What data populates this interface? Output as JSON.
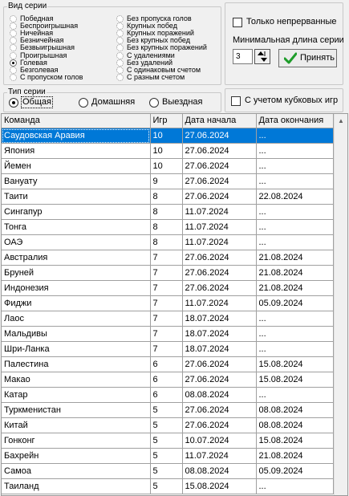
{
  "series_kind": {
    "legend": "Вид серии",
    "left_options": [
      {
        "label": "Победная",
        "checked": false
      },
      {
        "label": "Беспроигрышная",
        "checked": false
      },
      {
        "label": "Ничейная",
        "checked": false
      },
      {
        "label": "Безничейная",
        "checked": false
      },
      {
        "label": "Безвыигрышная",
        "checked": false
      },
      {
        "label": "Проигрышная",
        "checked": false
      },
      {
        "label": "Голевая",
        "checked": true
      },
      {
        "label": "Безголевая",
        "checked": false
      },
      {
        "label": "С пропуском голов",
        "checked": false
      }
    ],
    "right_options": [
      {
        "label": "Без пропуска голов",
        "checked": false
      },
      {
        "label": "Крупных побед",
        "checked": false
      },
      {
        "label": "Крупных поражений",
        "checked": false
      },
      {
        "label": "Без крупных побед",
        "checked": false
      },
      {
        "label": "Без крупных поражений",
        "checked": false
      },
      {
        "label": "С удалениями",
        "checked": false
      },
      {
        "label": "Без удалений",
        "checked": false
      },
      {
        "label": "С одинаковым счетом",
        "checked": false
      },
      {
        "label": "С разным счетом",
        "checked": false
      }
    ]
  },
  "options_panel": {
    "continuous_label": "Только непрерванные",
    "continuous_checked": false,
    "min_length_label": "Минимальная длина серии",
    "min_length_value": "3",
    "accept_label": "Принять"
  },
  "series_type": {
    "legend": "Тип серии",
    "options": [
      {
        "label": "Общая",
        "checked": true
      },
      {
        "label": "Домашняя",
        "checked": false
      },
      {
        "label": "Выездная",
        "checked": false
      }
    ]
  },
  "cup_games": {
    "label": "С учетом кубковых игр",
    "checked": false
  },
  "table": {
    "columns": [
      "Команда",
      "Игр",
      "Дата начала",
      "Дата окончания"
    ],
    "selected_index": 0,
    "rows": [
      [
        "Саудовская Аравия",
        "10",
        "27.06.2024",
        "..."
      ],
      [
        "Япония",
        "10",
        "27.06.2024",
        "..."
      ],
      [
        "Йемен",
        "10",
        "27.06.2024",
        "..."
      ],
      [
        "Вануату",
        "9",
        "27.06.2024",
        "..."
      ],
      [
        "Таити",
        "8",
        "27.06.2024",
        "22.08.2024"
      ],
      [
        "Сингапур",
        "8",
        "11.07.2024",
        "..."
      ],
      [
        "Тонга",
        "8",
        "11.07.2024",
        "..."
      ],
      [
        "ОАЭ",
        "8",
        "11.07.2024",
        "..."
      ],
      [
        "Австралия",
        "7",
        "27.06.2024",
        "21.08.2024"
      ],
      [
        "Бруней",
        "7",
        "27.06.2024",
        "21.08.2024"
      ],
      [
        "Индонезия",
        "7",
        "27.06.2024",
        "21.08.2024"
      ],
      [
        "Фиджи",
        "7",
        "11.07.2024",
        "05.09.2024"
      ],
      [
        "Лаос",
        "7",
        "18.07.2024",
        "..."
      ],
      [
        "Мальдивы",
        "7",
        "18.07.2024",
        "..."
      ],
      [
        "Шри-Ланка",
        "7",
        "18.07.2024",
        "..."
      ],
      [
        "Палестина",
        "6",
        "27.06.2024",
        "15.08.2024"
      ],
      [
        "Макао",
        "6",
        "27.06.2024",
        "15.08.2024"
      ],
      [
        "Катар",
        "6",
        "08.08.2024",
        "..."
      ],
      [
        "Туркменистан",
        "5",
        "27.06.2024",
        "08.08.2024"
      ],
      [
        "Китай",
        "5",
        "27.06.2024",
        "08.08.2024"
      ],
      [
        "Гонконг",
        "5",
        "10.07.2024",
        "15.08.2024"
      ],
      [
        "Бахрейн",
        "5",
        "11.07.2024",
        "21.08.2024"
      ],
      [
        "Самоа",
        "5",
        "08.08.2024",
        "05.09.2024"
      ],
      [
        "Таиланд",
        "5",
        "15.08.2024",
        "..."
      ]
    ]
  },
  "colors": {
    "selection": "#0078d7",
    "accept_check": "#1e9c2a"
  }
}
